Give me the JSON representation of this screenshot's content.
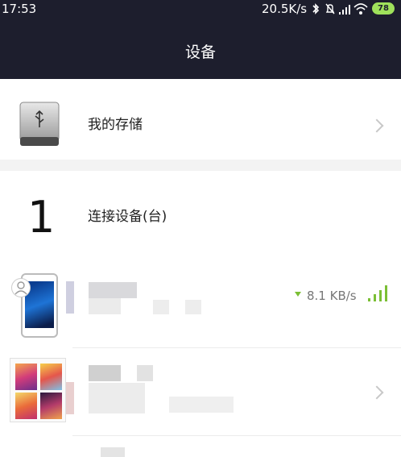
{
  "status_bar": {
    "time": "17:53",
    "network_speed": "20.5K/s",
    "battery": "78",
    "icons": [
      "bluetooth-icon",
      "mute-icon",
      "cell-signal-icon",
      "wifi-icon",
      "battery-icon"
    ]
  },
  "header": {
    "title": "设备"
  },
  "storage": {
    "label": "我的存储",
    "icon": "usb-drive-icon"
  },
  "connected": {
    "count": "1",
    "label": "连接设备(台)"
  },
  "devices": [
    {
      "icon": "phone-icon",
      "badge": "user-icon",
      "rate": "8.1 KB/s"
    },
    {
      "icon": "phone-gallery-icon"
    }
  ],
  "colors": {
    "header_bg": "#1d1e2d",
    "accent": "#7bbf35",
    "battery": "#9fe15b"
  }
}
